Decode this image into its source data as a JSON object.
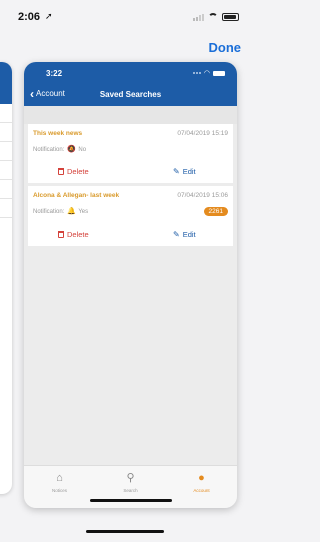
{
  "os": {
    "time": "2:06",
    "done_label": "Done"
  },
  "app": {
    "time": "3:22",
    "back_label": "Account",
    "title": "Saved Searches"
  },
  "searches": [
    {
      "title": "This week news",
      "date": "07/04/2019 15:19",
      "notification_label": "Notification:",
      "notification_value": "No",
      "delete_label": "Delete",
      "edit_label": "Edit",
      "badge": ""
    },
    {
      "title": "Alcona & Allegan- last week",
      "date": "07/04/2019 15:06",
      "notification_label": "Notification:",
      "notification_value": "Yes",
      "delete_label": "Delete",
      "edit_label": "Edit",
      "badge": "2261"
    }
  ],
  "tabs": [
    {
      "label": "Notices",
      "icon": "home-icon",
      "active": false
    },
    {
      "label": "Search",
      "icon": "search-icon",
      "active": false
    },
    {
      "label": "Account",
      "icon": "person-icon",
      "active": true
    }
  ],
  "colors": {
    "nav": "#1d5ca7",
    "accent": "#e48b1f",
    "delete": "#d4423b",
    "title": "#d99a2b"
  }
}
